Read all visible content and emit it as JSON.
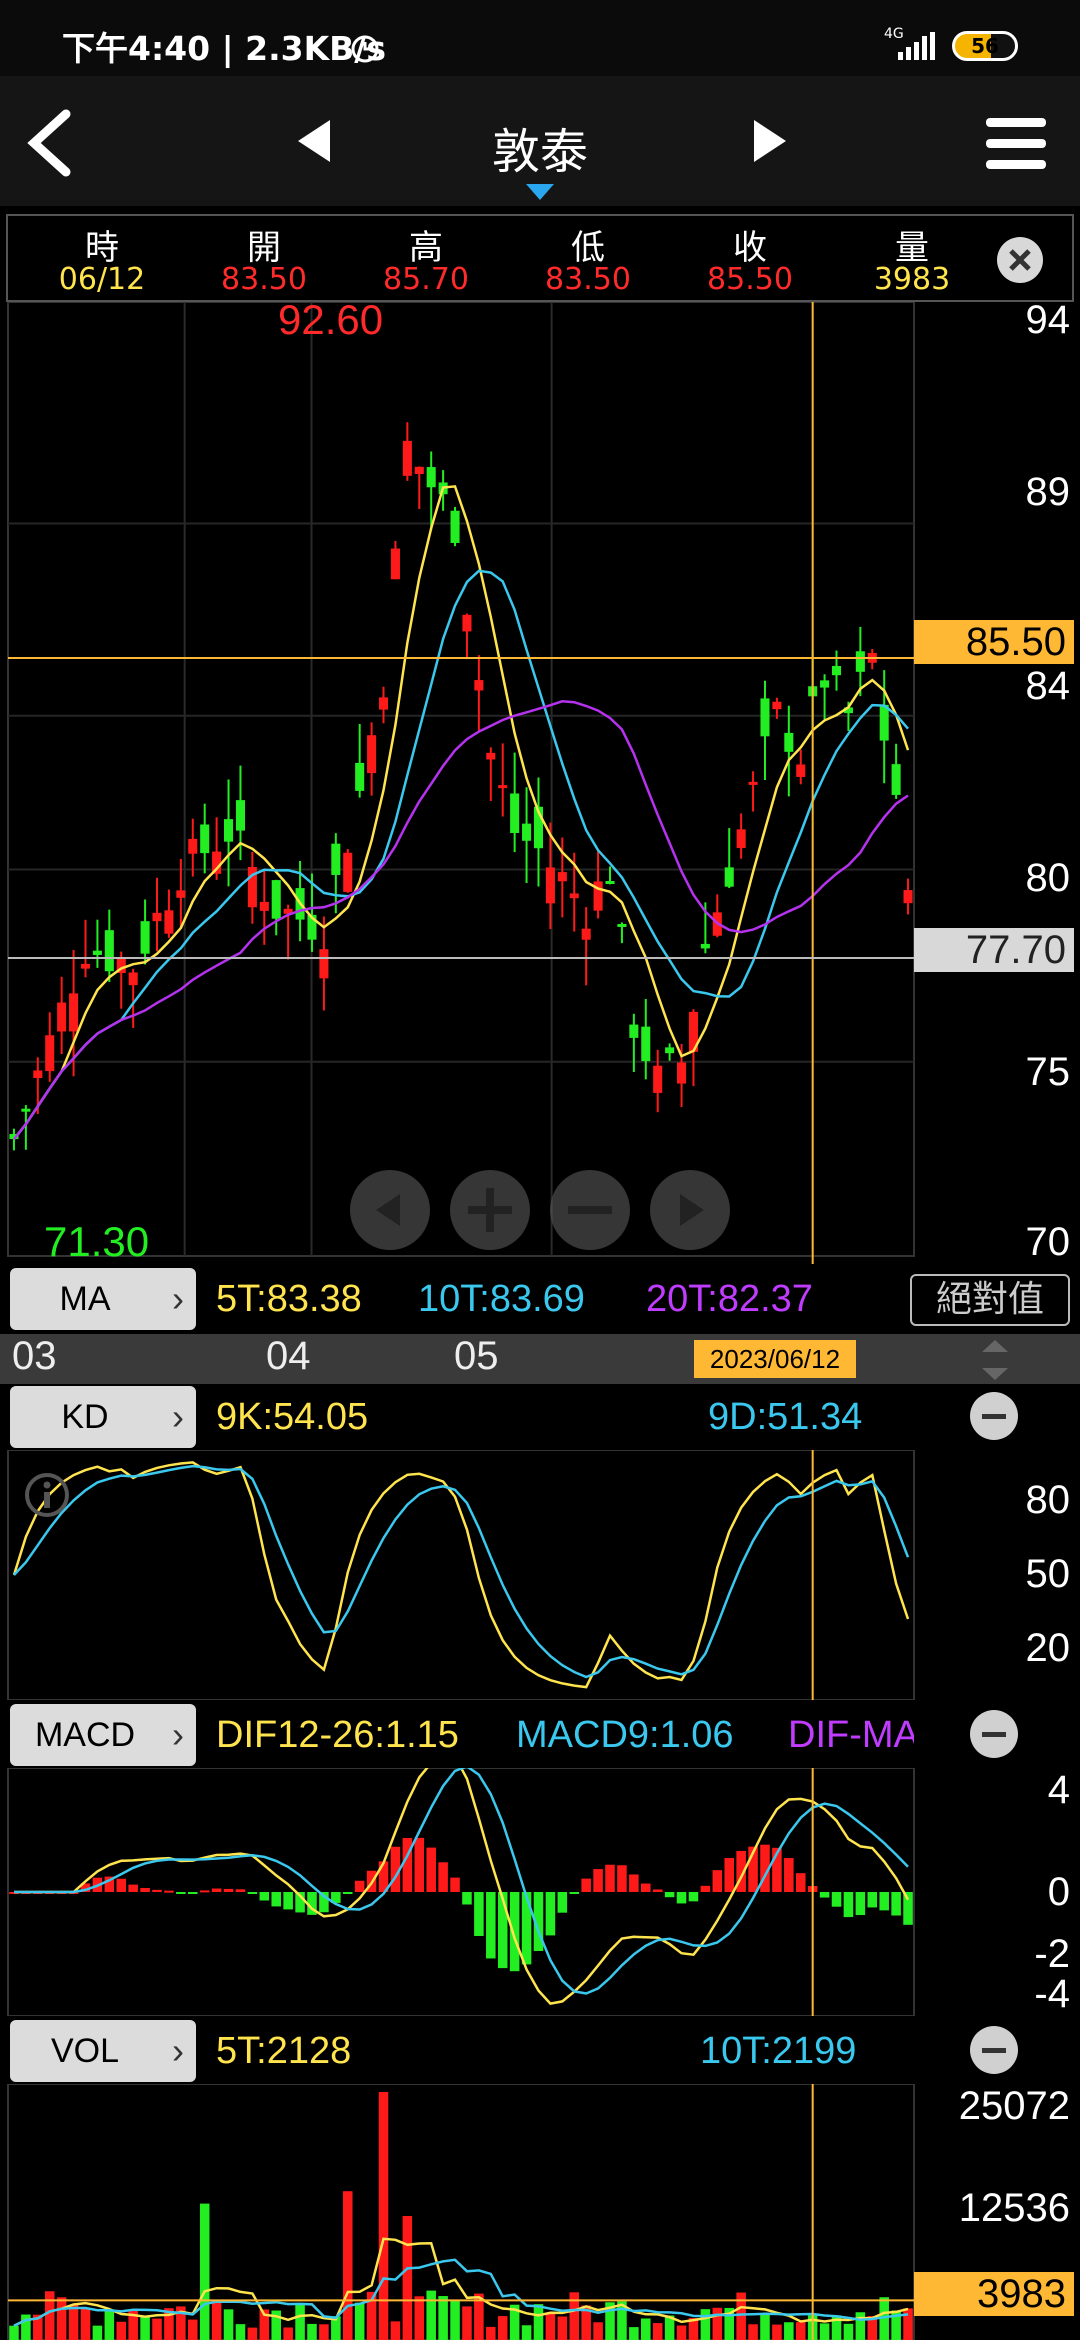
{
  "status_bar": {
    "time_speed": "下午4:40 | 2.3KB/s",
    "network": "4G",
    "battery": "56"
  },
  "nav": {
    "title": "敦泰"
  },
  "quote": {
    "labels": [
      "時",
      "開",
      "高",
      "低",
      "收",
      "量"
    ],
    "values": [
      "06/12",
      "83.50",
      "85.70",
      "83.50",
      "85.50",
      "3983"
    ]
  },
  "price_pane": {
    "high_label": "92.60",
    "low_label": "71.30",
    "y_ticks": [
      "94",
      "89",
      "84",
      "80",
      "75",
      "70"
    ],
    "y_range": [
      70,
      94.5
    ],
    "crosshair_price": "85.50",
    "last_price": "77.70",
    "colors": {
      "up": "#ff1a1a",
      "down": "#22ee22",
      "ma5": "#ffe44d",
      "ma10": "#3ac8ee",
      "ma20": "#b532ee",
      "crosshair": "#ffb833"
    }
  },
  "ma_bar": {
    "button": "MA",
    "ma5": "5T:83.38",
    "ma10": "10T:83.69",
    "ma20": "20T:82.37",
    "mode_button": "絕對值"
  },
  "time_axis": {
    "labels": [
      "03",
      "04",
      "05"
    ],
    "selected_date": "2023/06/12"
  },
  "kd": {
    "button": "KD",
    "k": "9K:54.05",
    "d": "9D:51.34",
    "y_ticks": [
      "80",
      "50",
      "20"
    ]
  },
  "macd": {
    "button": "MACD",
    "dif": "DIF12-26:1.15",
    "macd9": "MACD9:1.06",
    "osc": "DIF-MA",
    "y_ticks": [
      "4",
      "0",
      "-2",
      "-4"
    ]
  },
  "vol": {
    "button": "VOL",
    "v5": "5T:2128",
    "v10": "10T:2199",
    "y_ticks": [
      "25072",
      "12536"
    ],
    "current": "3983"
  }
}
